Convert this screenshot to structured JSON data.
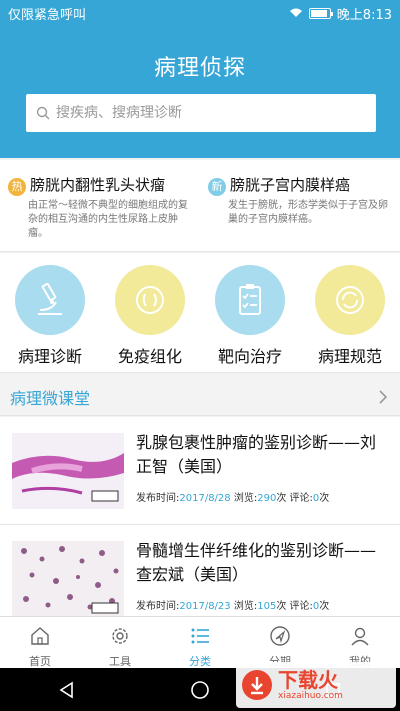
{
  "status_bar": {
    "left_text": "仅限紧急呼叫",
    "time": "晚上8:13",
    "battery_level": 0.9
  },
  "header": {
    "title": "病理侦探",
    "search_placeholder": "搜疾病、搜病理诊断"
  },
  "news": [
    {
      "badge": "热",
      "badge_color": "#f2b43b",
      "title": "膀胱内翻性乳头状瘤",
      "desc": "由正常～轻微不典型的细胞组成的复杂的相互沟通的内生性尿路上皮肿瘤。"
    },
    {
      "badge": "新",
      "badge_color": "#7fcde6",
      "title": "膀胱子宫内膜样癌",
      "desc": "发生于膀胱，形态学类似于子宫及卵巢的子宫内膜样癌。"
    }
  ],
  "features": [
    {
      "label": "病理诊断",
      "icon": "microscope-icon",
      "color": "#a8dcee"
    },
    {
      "label": "免疫组化",
      "icon": "cells-icon",
      "color": "#f2ea98"
    },
    {
      "label": "靶向治疗",
      "icon": "checklist-icon",
      "color": "#a8dcee"
    },
    {
      "label": "病理规范",
      "icon": "refresh-book-icon",
      "color": "#f2ea98"
    }
  ],
  "section": {
    "title": "病理微课堂"
  },
  "articles": [
    {
      "title": "乳腺包裹性肿瘤的鉴别诊断——刘正智（美国）",
      "date_label": "发布时间:",
      "date": "2017/8/28",
      "views_label": "浏览:",
      "views": "290",
      "views_unit": "次",
      "comments_label": "评论:",
      "comments": "0",
      "comments_unit": "次"
    },
    {
      "title": "骨髓增生伴纤维化的鉴别诊断——查宏斌（美国）",
      "date_label": "发布时间:",
      "date": "2017/8/23",
      "views_label": "浏览:",
      "views": "105",
      "views_unit": "次",
      "comments_label": "评论:",
      "comments": "0",
      "comments_unit": "次"
    }
  ],
  "tabs": [
    {
      "label": "首页",
      "icon": "home-icon"
    },
    {
      "label": "工具",
      "icon": "gear-icon"
    },
    {
      "label": "分类",
      "icon": "list-icon"
    },
    {
      "label": "分期",
      "icon": "navigation-arrow-icon"
    },
    {
      "label": "我的",
      "icon": "user-icon"
    }
  ],
  "watermark": {
    "big": "下载火",
    "small": "xiazaihuo.com"
  },
  "colors": {
    "primary": "#35a6d6",
    "accent": "#e8442f"
  }
}
